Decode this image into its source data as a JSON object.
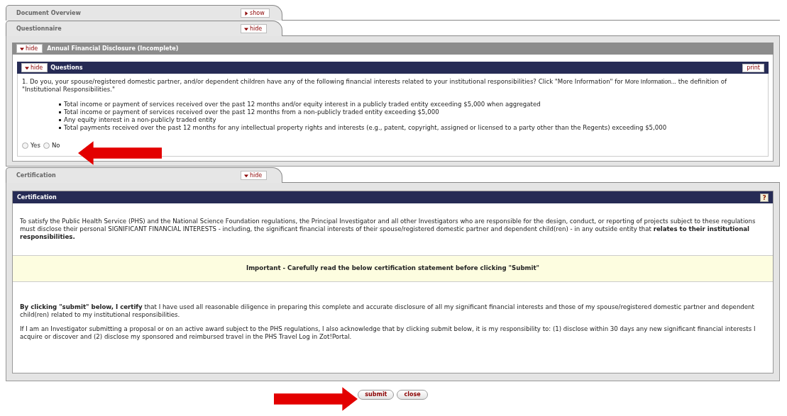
{
  "tabs": [
    {
      "title": "Document Overview",
      "toggle": "show",
      "expanded": false
    },
    {
      "title": "Questionnaire",
      "toggle": "hide",
      "expanded": true
    }
  ],
  "questionnaire": {
    "section": {
      "title": "Annual Financial Disclosure (Incomplete)",
      "toggle": "hide",
      "expanded": true
    },
    "questions": {
      "title": "Questions",
      "toggle": "hide",
      "expanded": true,
      "print": "print",
      "question_start": "1. Do you, your spouse/registered domestic partner, and/or dependent children have any of the following financial interests related to your institutional responsibilities? Click \"More Information\" for",
      "more_link": "More Information...",
      "question_end": "the definition of \"Institutional Responsibilities.\"",
      "bullets": [
        "Total income or payment of services received over the past 12 months and/or equity interest in a publicly traded entity exceeding $5,000 when aggregated",
        "Total income or payment of services received over the past 12 months from a non-publicly traded entity exceeding $5,000",
        "Any equity interest in a non-publicly traded entity",
        "Total payments received over the past 12 months for any intellectual property rights and interests (e.g., patent, copyright, assigned or licensed to a party other than the Regents) exceeding $5,000"
      ],
      "options": [
        {
          "label": "Yes",
          "selected": false
        },
        {
          "label": "No",
          "selected": false
        }
      ]
    }
  },
  "certification_tab": {
    "title": "Certification",
    "toggle": "hide",
    "expanded": true
  },
  "certification": {
    "title": "Certification",
    "help": "?",
    "paragraph": "To satisfy the Public Health Service (PHS) and the National Science Foundation regulations, the Principal Investigator and all other Investigators who are responsible for the design, conduct, or reporting of projects subject to these regulations must disclose their personal SIGNIFICANT FINANCIAL INTERESTS - including, the significant financial interests of their spouse/registered domestic partner and dependent child(ren) - in any outside entity that **relates to their institutional responsibilities.**",
    "important": "Important - Carefully read the below certification statement before clicking \"Submit\"",
    "statement": "**By clicking \"submit\" below, I certify** that I have used all reasonable diligence in preparing this complete and accurate disclosure of all my significant financial interests and those of my spouse/registered domestic partner and dependent child(ren) related to my institutional responsibilities.",
    "note": "If I am an Investigator submitting a proposal or on an active award subject to the PHS regulations, I also acknowledge that by clicking submit below, it is my responsibility to: (1) disclose within 30 days any new significant financial interests I acquire or discover and (2) disclose my sponsored and reimbursed travel in the PHS Travel Log in Zot!Portal."
  },
  "buttons": [
    {
      "label": "submit"
    },
    {
      "label": "close"
    }
  ]
}
